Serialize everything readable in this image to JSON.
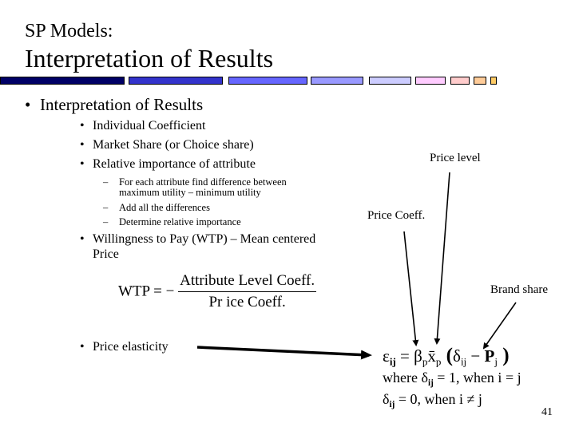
{
  "header": {
    "subtitle": "SP Models:",
    "title": "Interpretation of Results",
    "bar_colors": [
      "#000066",
      "#3333cc",
      "#6666ff",
      "#9999ff",
      "#ccccff",
      "#ffccff",
      "#ffcccc",
      "#ffcc99",
      "#ffcc66"
    ]
  },
  "body": {
    "main_bullet": "Interpretation of Results",
    "sub_bullets": [
      "Individual Coefficient",
      "Market Share (or Choice share)",
      "Relative importance of attribute"
    ],
    "dash_items": [
      "For each attribute find  difference between",
      "maximum utility – minimum utility",
      "Add all the differences",
      "Determine relative importance"
    ],
    "wtp_bullet_line1": "Willingness to Pay (WTP) – Mean centered",
    "wtp_bullet_line2": "Price",
    "wtp_formula": {
      "lhs": "WTP = −",
      "numerator": "Attribute Level Coeff.",
      "denominator": "Pr ice Coeff."
    },
    "elasticity_bullet": "Price elasticity"
  },
  "annotations": {
    "price_level": "Price level",
    "price_coeff": "Price Coeff.",
    "brand_share": "Brand share"
  },
  "elasticity_formula": {
    "line1": {
      "eps": "ε",
      "eps_sub": "ij",
      "eq": " = ",
      "beta": "β",
      "beta_sub": "p",
      "xbar": "x̄",
      "xbar_sub": "p",
      "open": " (",
      "delta": "δ",
      "delta_sub": "ij",
      "minus": " − ",
      "P": "P",
      "P_sub": "j",
      "close": " )"
    },
    "line2": {
      "prefix": "where ",
      "delta": "δ",
      "delta_sub": "ij",
      "rest": " = 1, when i = j"
    },
    "line3": {
      "delta": "δ",
      "delta_sub": "ij",
      "rest": " = 0, when i ≠ j"
    }
  },
  "footer": {
    "page_number": "41"
  },
  "glyphs": {
    "bullet": "•",
    "dash": "–"
  }
}
